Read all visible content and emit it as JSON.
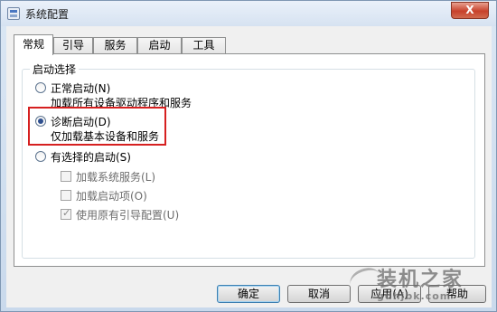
{
  "window": {
    "title": "系统配置",
    "close_label": "X"
  },
  "tabs": [
    {
      "label": "常规",
      "active": true
    },
    {
      "label": "引导",
      "active": false
    },
    {
      "label": "服务",
      "active": false
    },
    {
      "label": "启动",
      "active": false
    },
    {
      "label": "工具",
      "active": false
    }
  ],
  "startup": {
    "group_label": "启动选择",
    "options": [
      {
        "label": "正常启动(N)",
        "description": "加载所有设备驱动程序和服务",
        "selected": false
      },
      {
        "label": "诊断启动(D)",
        "description": "仅加载基本设备和服务",
        "selected": true
      },
      {
        "label": "有选择的启动(S)",
        "selected": false
      }
    ],
    "selective_items": [
      {
        "label": "加载系统服务(L)",
        "checked": false
      },
      {
        "label": "加载启动项(O)",
        "checked": false
      },
      {
        "label": "使用原有引导配置(U)",
        "checked": true
      }
    ]
  },
  "buttons": {
    "ok": "确定",
    "cancel": "取消",
    "apply": "应用(A)",
    "help": "帮助"
  },
  "watermark": {
    "text": "装机之家",
    "url": "gdhjbk.com"
  },
  "colors": {
    "highlight": "#d62020",
    "title_gradient_top": "#eaf1fa"
  }
}
